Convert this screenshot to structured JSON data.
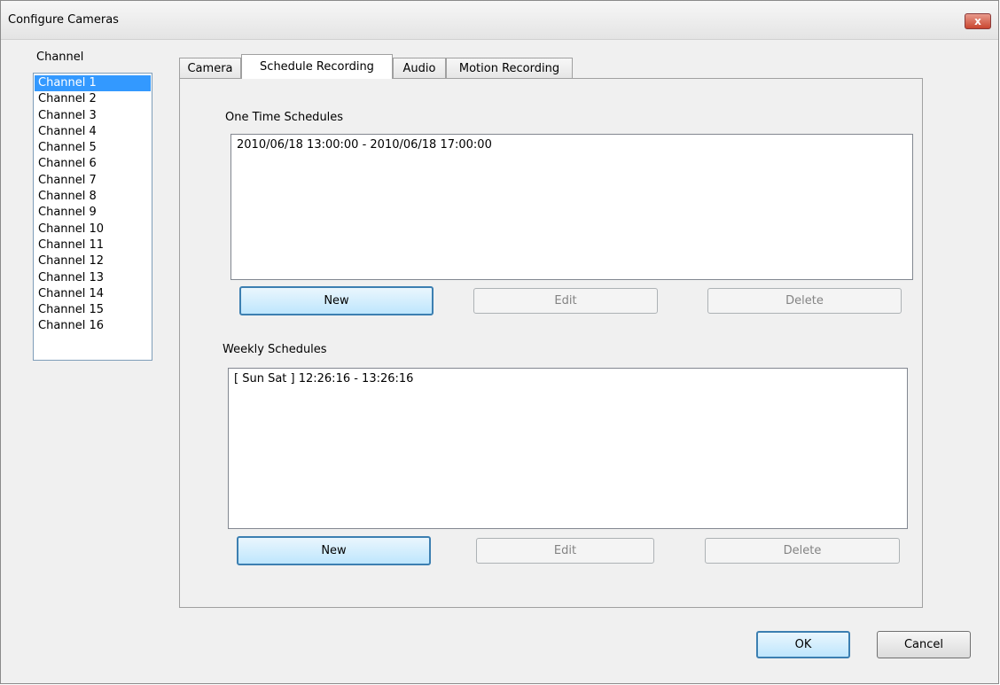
{
  "window": {
    "title": "Configure Cameras",
    "close_glyph": "x"
  },
  "channel_panel": {
    "label": "Channel",
    "items": [
      "Channel 1",
      "Channel 2",
      "Channel 3",
      "Channel 4",
      "Channel 5",
      "Channel 6",
      "Channel 7",
      "Channel 8",
      "Channel 9",
      "Channel 10",
      "Channel 11",
      "Channel 12",
      "Channel 13",
      "Channel 14",
      "Channel 15",
      "Channel 16"
    ],
    "selected": "Channel 1"
  },
  "tabs": [
    "Camera",
    "Schedule Recording",
    "Audio",
    "Motion Recording"
  ],
  "active_tab": "Schedule Recording",
  "one_time": {
    "label": "One Time Schedules",
    "entries": [
      "2010/06/18 13:00:00 - 2010/06/18 17:00:00"
    ],
    "buttons": {
      "new": "New",
      "edit": "Edit",
      "delete": "Delete"
    }
  },
  "weekly": {
    "label": "Weekly Schedules",
    "entries": [
      "[ Sun Sat ] 12:26:16 - 13:26:16"
    ],
    "buttons": {
      "new": "New",
      "edit": "Edit",
      "delete": "Delete"
    }
  },
  "footer": {
    "ok": "OK",
    "cancel": "Cancel"
  },
  "colors": {
    "selection": "#3399ff",
    "primary_border": "#3c7fb1",
    "close_button": "#c9462f"
  }
}
